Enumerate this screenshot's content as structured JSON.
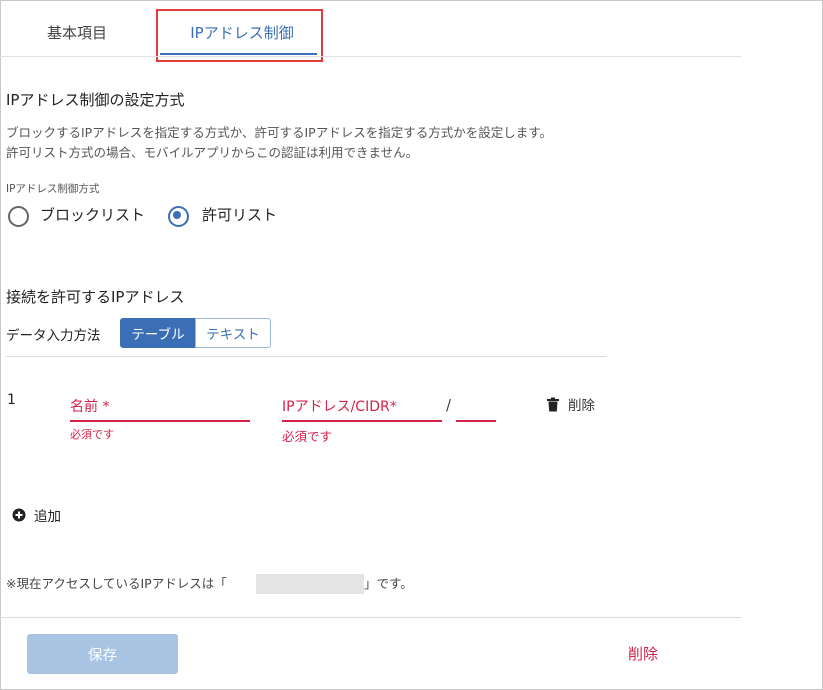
{
  "tabs": {
    "basic": "基本項目",
    "ip_control": "IPアドレス制御"
  },
  "method_section": {
    "title": "IPアドレス制御の設定方式",
    "description_line1": "ブロックするIPアドレスを指定する方式か、許可するIPアドレスを指定する方式かを設定します。",
    "description_line2": "許可リスト方式の場合、モバイルアプリからこの認証は利用できません。",
    "field_label": "IPアドレス制御方式",
    "options": [
      {
        "label": "ブロックリスト",
        "selected": false
      },
      {
        "label": "許可リスト",
        "selected": true
      }
    ]
  },
  "allowed_section": {
    "title": "接続を許可するIPアドレス",
    "input_method_label": "データ入力方法",
    "segments": {
      "table": "テーブル",
      "text": "テキスト"
    },
    "selected_segment": "テーブル"
  },
  "row": {
    "index": "1",
    "name_placeholder": "名前 *",
    "name_error": "必須です",
    "ip_placeholder": "IPアドレス/CIDR*",
    "ip_error": "必須です",
    "slash": "/",
    "delete_label": "削除"
  },
  "add_label": "追加",
  "current_ip_note": {
    "prefix": "※現在アクセスしているIPアドレスは「",
    "suffix": "」です。"
  },
  "footer": {
    "save_label": "保存",
    "delete_label": "削除"
  },
  "colors": {
    "primary": "#3a6fb5",
    "error": "#d6224b",
    "save_disabled": "#a9c3e3"
  }
}
